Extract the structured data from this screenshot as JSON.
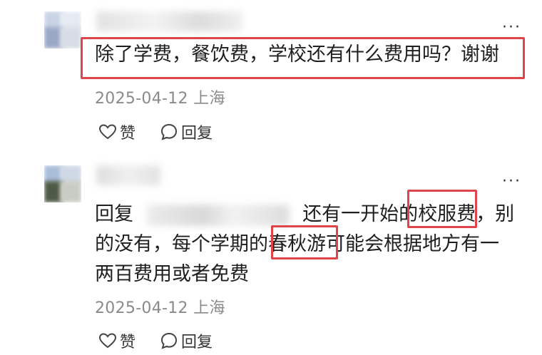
{
  "comments": [
    {
      "text": "除了学费，餐饮费，学校还有什么费用吗？谢谢",
      "date": "2025-04-12",
      "location": "上海",
      "like_label": "赞",
      "reply_label": "回复"
    },
    {
      "reply_prefix": "回复",
      "line1_a": "还有一开始的",
      "line1_hl": "校服费",
      "line1_b": "，别",
      "line2_a": "的没有，每个学期的",
      "line2_hl": "春秋游",
      "line2_b": "可能会根据地方有一",
      "line3": "两百费用或者免费",
      "date": "2025-04-12",
      "location": "上海",
      "like_label": "赞",
      "reply_label": "回复"
    }
  ],
  "more_label": "···",
  "colors": {
    "highlight": "#e0444b",
    "meta": "#8a8a8a"
  }
}
